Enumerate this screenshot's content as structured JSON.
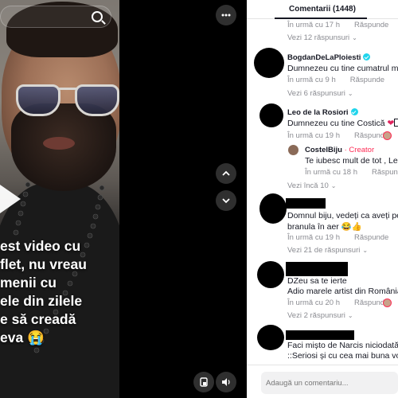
{
  "video": {
    "caption_lines": [
      "est video cu",
      "flet, nu vreau",
      "menii cu",
      "ele din zilele",
      "e să creadă",
      "eva 😭"
    ]
  },
  "panel": {
    "header": "Comentarii (1448)",
    "comments": [
      {
        "meta_time": "În urmă cu 17 h",
        "meta_reply": "Răspunde",
        "more": "Vezi 12 răspunsuri"
      },
      {
        "username": "BogdanDeLaPloiesti",
        "text": "Dumnezeu cu tine cumatrul me",
        "meta_time": "În urmă cu 9 h",
        "meta_reply": "Răspunde",
        "more": "Vezi 6 răspunsuri"
      },
      {
        "username": "Leo de la Rosiori",
        "text": "Dumnezeu cu tine Costică",
        "meta_time": "În urmă cu 19 h",
        "meta_reply": "Răspunde",
        "reply": {
          "username": "CostelBiju",
          "creator_label": "· Creator",
          "text": "Te iubesc mult de tot , Leu",
          "meta_time": "În urmă cu 18 h",
          "meta_reply": "Răspunde"
        },
        "more": "Vezi încă 10"
      },
      {
        "text_line1": "Domnul biju, vedeți ca aveți per",
        "text_line2": "branula în aer 😂👍",
        "meta_time": "În urmă cu 19 h",
        "meta_reply": "Răspunde",
        "more": "Vezi 21 de răspunsuri"
      },
      {
        "text_line1": "DZeu sa te ierte",
        "text_line2": "Adio marele artist din România",
        "meta_time": "În urmă cu 20 h",
        "meta_reply": "Răspunde",
        "more": "Vezi 2 răspunsuri"
      },
      {
        "text_line1": "Faci mișto de Narcis niciodată n",
        "text_line2": "::Seriosi și cu cea mai buna voc"
      }
    ],
    "input_placeholder": "Adaugă un comentariu..."
  }
}
